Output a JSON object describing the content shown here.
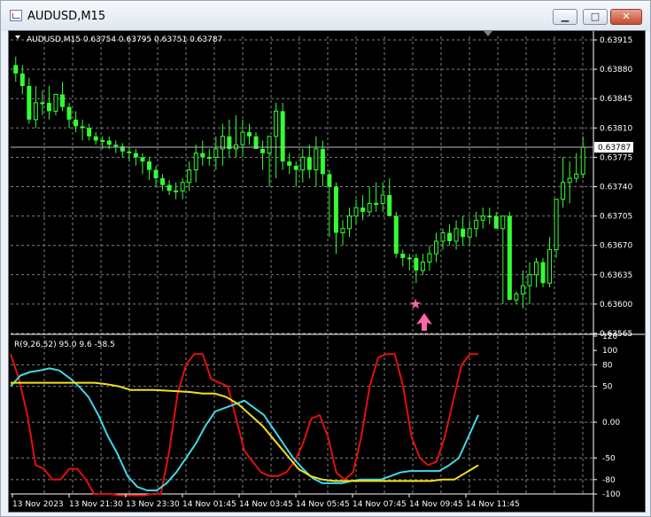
{
  "window": {
    "title": "AUDUSD,M15",
    "minimize_glyph": "▁",
    "maximize_glyph": "□",
    "close_glyph": "✕"
  },
  "price_chart": {
    "info": "AUDUSD,M15  0.63754 0.63795 0.63751 0.63787",
    "current_price": "0.63787",
    "price_labels": [
      "0.63915",
      "0.63880",
      "0.63845",
      "0.63810",
      "0.63775",
      "0.63740",
      "0.63705",
      "0.63670",
      "0.63635",
      "0.63600",
      "0.63565"
    ],
    "marker_star": "★"
  },
  "indicator": {
    "label": "R(9,26,52) 95.0 9.6 -58.5",
    "scale_labels": [
      "120",
      "100",
      "80",
      "50",
      "0.00",
      "-50",
      "-80",
      "-100"
    ]
  },
  "time_labels": [
    "13 Nov 2023",
    "13 Nov 21:30",
    "13 Nov 23:30",
    "14 Nov 01:45",
    "14 Nov 03:45",
    "14 Nov 05:45",
    "14 Nov 07:45",
    "14 Nov 09:45",
    "14 Nov 11:45"
  ],
  "colors": {
    "background": "#000000",
    "candle": "#33ff33",
    "grid": "#808080",
    "red_line": "#e01010",
    "cyan_line": "#40d8e8",
    "yellow_line": "#f0e020",
    "marker": "#ff66aa"
  },
  "chart_data": [
    {
      "type": "candlestick",
      "title": "AUDUSD,M15",
      "ylim": [
        0.63565,
        0.63915
      ],
      "open": [
        0.63885,
        0.63875,
        0.6386,
        0.6382,
        0.6384,
        0.6384,
        0.6383,
        0.6385,
        0.63835,
        0.6382,
        0.63812,
        0.6381,
        0.638,
        0.63795,
        0.63795,
        0.6379,
        0.63788,
        0.63782,
        0.6378,
        0.63775,
        0.6377,
        0.6376,
        0.6375,
        0.63742,
        0.63735,
        0.63735,
        0.63745,
        0.6376,
        0.6378,
        0.63775,
        0.63775,
        0.63785,
        0.638,
        0.63785,
        0.6379,
        0.63805,
        0.638,
        0.63785,
        0.6378,
        0.638,
        0.6383,
        0.6377,
        0.63765,
        0.6376,
        0.63775,
        0.6376,
        0.63785,
        0.63755,
        0.6374,
        0.63685,
        0.6369,
        0.63705,
        0.63715,
        0.6371,
        0.6372,
        0.6372,
        0.6373,
        0.63705,
        0.6366,
        0.63655,
        0.63655,
        0.6364,
        0.6365,
        0.6366,
        0.63675,
        0.63685,
        0.63675,
        0.6369,
        0.6368,
        0.6369,
        0.637,
        0.63705,
        0.63705,
        0.6369,
        0.63705,
        0.63605,
        0.63612,
        0.63622,
        0.63635,
        0.6365,
        0.63625,
        0.63665,
        0.63725,
        0.63745,
        0.6375,
        0.63755
      ],
      "high": [
        0.63895,
        0.63885,
        0.6387,
        0.6386,
        0.63855,
        0.6386,
        0.6385,
        0.63865,
        0.6384,
        0.6383,
        0.6382,
        0.63815,
        0.63805,
        0.638,
        0.638,
        0.63795,
        0.63792,
        0.63788,
        0.63785,
        0.6378,
        0.63775,
        0.63765,
        0.63755,
        0.63748,
        0.63745,
        0.6375,
        0.6377,
        0.6379,
        0.63795,
        0.63785,
        0.638,
        0.63815,
        0.6382,
        0.63825,
        0.6382,
        0.63815,
        0.63805,
        0.63795,
        0.638,
        0.6384,
        0.6384,
        0.6378,
        0.6377,
        0.63785,
        0.6379,
        0.638,
        0.63795,
        0.6376,
        0.63745,
        0.637,
        0.63715,
        0.63725,
        0.6373,
        0.6374,
        0.63745,
        0.63745,
        0.6375,
        0.6371,
        0.63665,
        0.6366,
        0.6366,
        0.6366,
        0.6367,
        0.63685,
        0.6369,
        0.63695,
        0.637,
        0.63705,
        0.637,
        0.6371,
        0.63715,
        0.63715,
        0.6371,
        0.637,
        0.6371,
        0.63615,
        0.6364,
        0.6365,
        0.63655,
        0.63655,
        0.6368,
        0.63725,
        0.63775,
        0.6377,
        0.6378,
        0.638
      ],
      "low": [
        0.63865,
        0.6385,
        0.63815,
        0.6381,
        0.63825,
        0.6382,
        0.63825,
        0.6383,
        0.6381,
        0.63805,
        0.63795,
        0.63795,
        0.6379,
        0.63785,
        0.63785,
        0.6378,
        0.63775,
        0.6377,
        0.63765,
        0.63755,
        0.63748,
        0.6374,
        0.63735,
        0.6373,
        0.63725,
        0.63725,
        0.63735,
        0.63745,
        0.63765,
        0.63765,
        0.6376,
        0.63765,
        0.63775,
        0.63775,
        0.63775,
        0.6379,
        0.6379,
        0.6376,
        0.6374,
        0.6375,
        0.6376,
        0.63755,
        0.6374,
        0.63745,
        0.6375,
        0.6374,
        0.6374,
        0.6368,
        0.6366,
        0.6367,
        0.6368,
        0.63695,
        0.637,
        0.63705,
        0.6371,
        0.6371,
        0.6372,
        0.63655,
        0.63645,
        0.6364,
        0.63625,
        0.63635,
        0.6364,
        0.6365,
        0.63665,
        0.6367,
        0.63665,
        0.6367,
        0.6367,
        0.6368,
        0.6369,
        0.63695,
        0.6369,
        0.636,
        0.63605,
        0.636,
        0.63595,
        0.636,
        0.6362,
        0.6362,
        0.6362,
        0.63655,
        0.63715,
        0.6372,
        0.63745,
        0.6375
      ],
      "close": [
        0.63875,
        0.6386,
        0.6382,
        0.6384,
        0.6384,
        0.6383,
        0.6385,
        0.63835,
        0.6382,
        0.63812,
        0.6381,
        0.638,
        0.63795,
        0.63795,
        0.6379,
        0.63788,
        0.63782,
        0.6378,
        0.63775,
        0.6377,
        0.6376,
        0.6375,
        0.63742,
        0.63735,
        0.63735,
        0.63745,
        0.6376,
        0.6378,
        0.63775,
        0.63775,
        0.63785,
        0.638,
        0.63785,
        0.6379,
        0.63805,
        0.638,
        0.63785,
        0.6378,
        0.638,
        0.6383,
        0.6377,
        0.63765,
        0.6376,
        0.63775,
        0.6376,
        0.63785,
        0.63755,
        0.6374,
        0.63685,
        0.6369,
        0.63705,
        0.63715,
        0.6371,
        0.6372,
        0.6372,
        0.6373,
        0.63705,
        0.6366,
        0.63655,
        0.63655,
        0.6364,
        0.6365,
        0.6366,
        0.63675,
        0.63685,
        0.63675,
        0.6369,
        0.6368,
        0.6369,
        0.637,
        0.63705,
        0.63705,
        0.6369,
        0.63705,
        0.63605,
        0.63612,
        0.63622,
        0.63635,
        0.6365,
        0.63625,
        0.63665,
        0.63725,
        0.63745,
        0.6375,
        0.63755,
        0.63787
      ]
    },
    {
      "type": "line",
      "title": "R(9,26,52) 95.0 9.6 -58.5",
      "ylim": [
        -100,
        120
      ],
      "series": [
        {
          "name": "",
          "values": [
            95,
            60,
            10,
            -60,
            -65,
            -80,
            -80,
            -65,
            -65,
            -80,
            -100,
            -100,
            -100,
            -102,
            -102,
            -102,
            -102,
            -100,
            -100,
            -40,
            40,
            80,
            95,
            95,
            60,
            55,
            50,
            5,
            -40,
            -55,
            -70,
            -75,
            -75,
            -70,
            -55,
            -30,
            5,
            10,
            -20,
            -70,
            -80,
            -70,
            -20,
            50,
            90,
            95,
            95,
            50,
            -20,
            -50,
            -60,
            -55,
            -20,
            30,
            80,
            95,
            95
          ]
        },
        {
          "name": "",
          "values": [
            50,
            65,
            70,
            72,
            75,
            72,
            62,
            50,
            35,
            10,
            -20,
            -45,
            -75,
            -90,
            -95,
            -95,
            -85,
            -70,
            -50,
            -30,
            -5,
            15,
            20,
            25,
            30,
            20,
            10,
            -10,
            -30,
            -50,
            -65,
            -78,
            -85,
            -85,
            -85,
            -82,
            -80,
            -80,
            -80,
            -75,
            -70,
            -68,
            -68,
            -68,
            -68,
            -60,
            -50,
            -20,
            10
          ]
        },
        {
          "name": "",
          "values": [
            55,
            55,
            55,
            55,
            55,
            55,
            55,
            55,
            53,
            50,
            45,
            45,
            45,
            44,
            43,
            42,
            40,
            40,
            35,
            25,
            10,
            -5,
            -25,
            -45,
            -65,
            -75,
            -80,
            -82,
            -82,
            -82,
            -82,
            -82,
            -82,
            -82,
            -82,
            -82,
            -80,
            -80,
            -70,
            -60
          ]
        }
      ]
    }
  ]
}
